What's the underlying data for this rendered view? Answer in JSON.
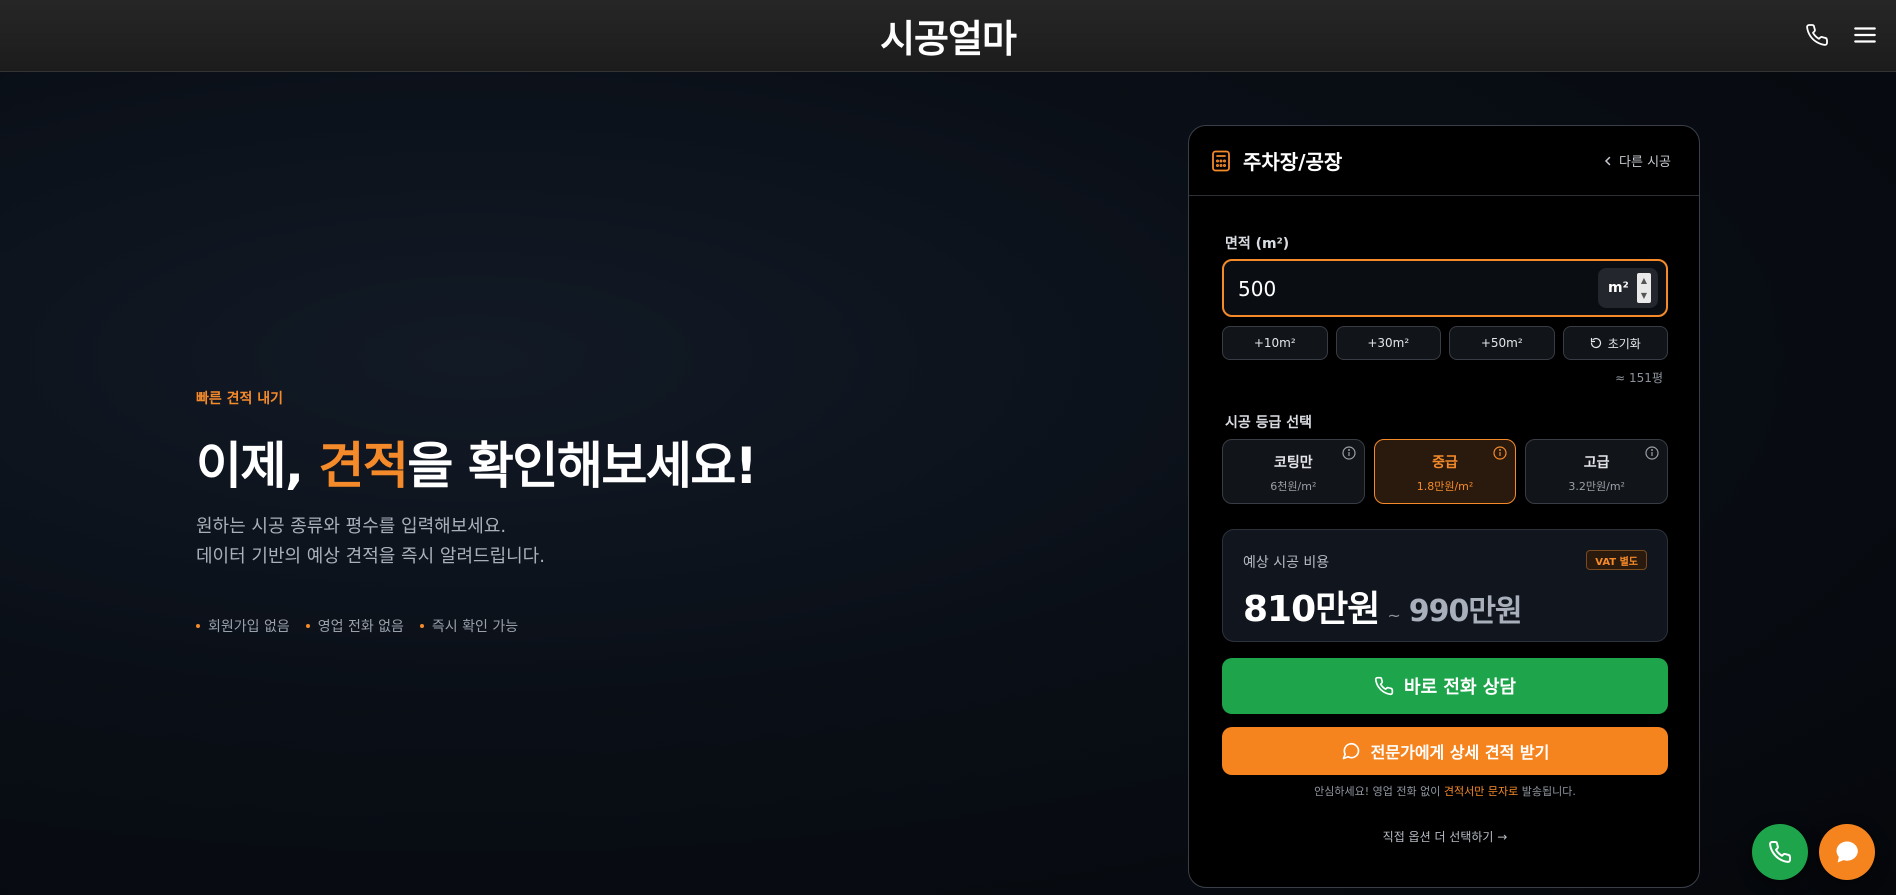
{
  "header": {
    "brand": "시공얼마"
  },
  "hero": {
    "eyebrow": "빠른 견적 내기",
    "headline_pre": "이제, ",
    "headline_highlight": "견적",
    "headline_post": "을 확인해보세요!",
    "desc_line1": "원하는 시공 종류와 평수를 입력해보세요.",
    "desc_line2": "데이터 기반의 예상 견적을 즉시 알려드립니다.",
    "bullets": [
      "회원가입 없음",
      "영업 전화 없음",
      "즉시 확인 가능"
    ]
  },
  "card": {
    "title": "주차장/공장",
    "back_label": "다른 시공",
    "area_label": "면적 (m²)",
    "area_value": "500",
    "unit": "m²",
    "quick_adds": [
      "+10m²",
      "+30m²",
      "+50m²"
    ],
    "reset_label": "초기화",
    "pyeong": "≈ 151평",
    "grade_label": "시공 등급 선택",
    "grades": [
      {
        "name": "코팅만",
        "price": "6천원/m²"
      },
      {
        "name": "중급",
        "price": "1.8만원/m²"
      },
      {
        "name": "고급",
        "price": "3.2만원/m²"
      }
    ],
    "selected_grade": "중급",
    "estimate_label": "예상 시공 비용",
    "vat_badge": "VAT 별도",
    "estimate_min": "810만원",
    "estimate_tilde": "~",
    "estimate_max": "990만원",
    "call_button": "바로 전화 상담",
    "quote_button": "전문가에게 상세 견적 받기",
    "notice_pre": "안심하세요! 영업 전화 없이 ",
    "notice_highlight": "견적서만 문자로",
    "notice_post": " 발송됩니다.",
    "more_link": "직접 옵션 더 선택하기 →"
  },
  "colors": {
    "accent": "#f58a2a",
    "call_green": "#1ea54c",
    "background": "#0a0f17"
  },
  "icons": [
    "phone-icon",
    "menu-icon",
    "calculator-icon",
    "chevron-left-icon",
    "reset-icon",
    "info-icon",
    "chat-bubble-icon"
  ]
}
